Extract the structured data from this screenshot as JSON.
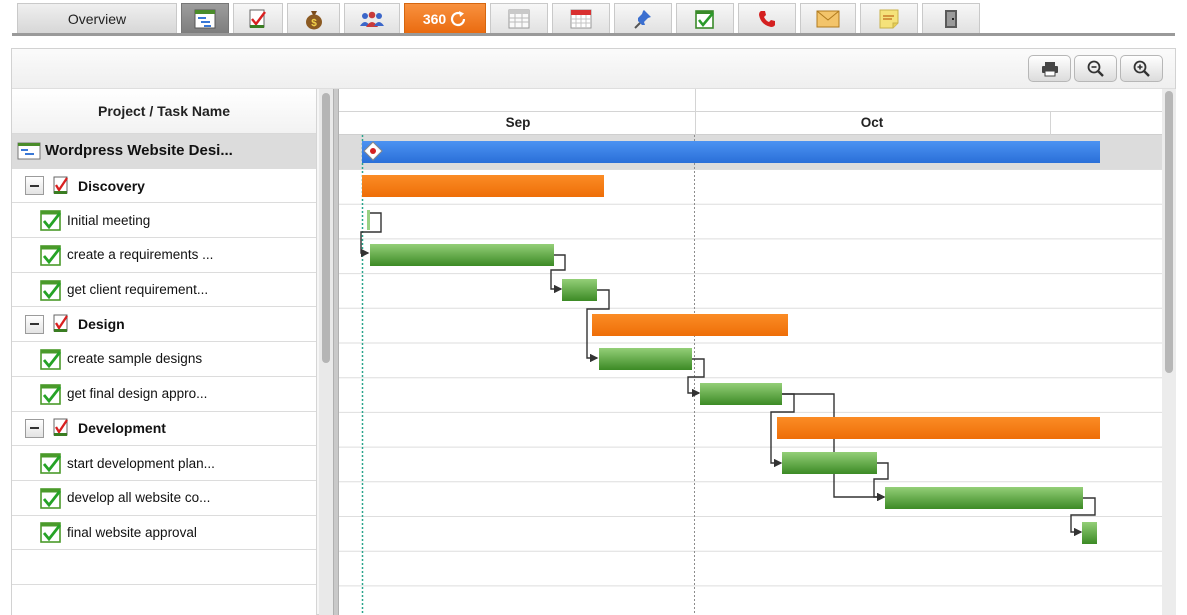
{
  "tabs": {
    "overview_label": "Overview",
    "t360_label": "360",
    "icons": [
      "gantt-icon",
      "task-icon",
      "budget-icon",
      "team-icon",
      "360-icon",
      "calendar-grid-icon",
      "calendar-icon",
      "pin-icon",
      "checklist-icon",
      "phone-icon",
      "mail-icon",
      "note-icon",
      "exit-icon"
    ],
    "active_index": 0
  },
  "toolbar": {
    "buttons": [
      "print-icon",
      "zoom-out-icon",
      "zoom-in-icon"
    ]
  },
  "grid": {
    "header": "Project / Task Name",
    "project": "Wordpress Website Desi...",
    "rows": [
      {
        "type": "group",
        "label": "Discovery"
      },
      {
        "type": "task",
        "label": "Initial meeting"
      },
      {
        "type": "task",
        "label": "create a requirements ..."
      },
      {
        "type": "task",
        "label": "get client requirement..."
      },
      {
        "type": "group",
        "label": "Design"
      },
      {
        "type": "task",
        "label": "create sample designs"
      },
      {
        "type": "task",
        "label": "get final design appro..."
      },
      {
        "type": "group",
        "label": "Development"
      },
      {
        "type": "task",
        "label": "start development plan..."
      },
      {
        "type": "task",
        "label": "develop all website co..."
      },
      {
        "type": "task",
        "label": "final website approval"
      }
    ]
  },
  "timeline": {
    "months": [
      "Sep",
      "Oct"
    ]
  },
  "colors": {
    "project_bar": "#3a82e6",
    "group_bar": "#f57d10",
    "task_bar_top": "#8fcb72",
    "task_bar_bottom": "#3e8c27",
    "today_line": "#2aa58d",
    "tab_active_360": "#ee7420"
  }
}
